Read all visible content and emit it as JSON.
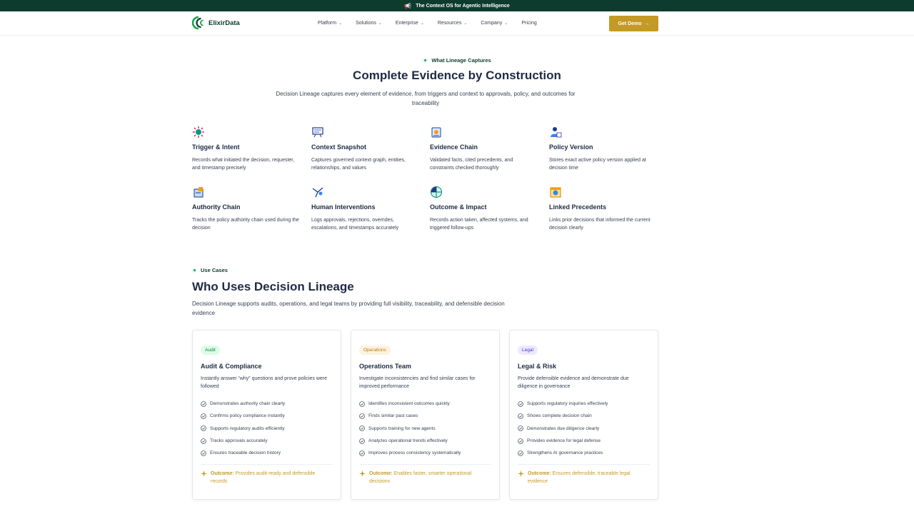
{
  "banner": {
    "icon": "megaphone-icon",
    "text": "The Context OS for Agentic Intelligence"
  },
  "nav": {
    "logo_text": "ElixirData",
    "items": [
      {
        "label": "Platform",
        "dropdown": true
      },
      {
        "label": "Solutions",
        "dropdown": true
      },
      {
        "label": "Enterprise",
        "dropdown": true
      },
      {
        "label": "Resources",
        "dropdown": true
      },
      {
        "label": "Company",
        "dropdown": true
      },
      {
        "label": "Pricing",
        "dropdown": false
      }
    ],
    "cta": "Get Demo",
    "cta_color": "#c49a24"
  },
  "lineage": {
    "eyebrow": "What Lineage Captures",
    "title": "Complete Evidence by Construction",
    "subtitle": "Decision Lineage captures every element of evidence, from triggers and context to approvals, policy, and outcomes for traceability",
    "features": [
      {
        "icon": "trigger-icon",
        "title": "Trigger & Intent",
        "desc": "Records what initiated the decision, requester, and timestamp precisely"
      },
      {
        "icon": "context-snapshot-icon",
        "title": "Context Snapshot",
        "desc": "Captures governed context graph, entities, relationships, and values"
      },
      {
        "icon": "evidence-chain-icon",
        "title": "Evidence Chain",
        "desc": "Validated facts, cited precedents, and constraints checked thoroughly"
      },
      {
        "icon": "policy-user-icon",
        "title": "Policy Version",
        "desc": "Stores exact active policy version applied at decision time"
      },
      {
        "icon": "authority-chain-icon",
        "title": "Authority Chain",
        "desc": "Tracks the policy authority chain used during the decision"
      },
      {
        "icon": "human-intervention-icon",
        "title": "Human Interventions",
        "desc": "Logs approvals, rejections, overrides, escalations, and timestamps accurately"
      },
      {
        "icon": "globe-impact-icon",
        "title": "Outcome & Impact",
        "desc": "Records action taken, affected systems, and triggered follow-ups"
      },
      {
        "icon": "linked-precedents-icon",
        "title": "Linked Precedents",
        "desc": "Links prior decisions that informed the current decision clearly"
      }
    ]
  },
  "use_cases": {
    "eyebrow": "Use Cases",
    "title": "Who Uses Decision Lineage",
    "subtitle": "Decision Lineage supports audits, operations, and legal teams by providing full visibility, traceability, and defensible decision evidence",
    "cards": [
      {
        "badge": "Audit",
        "badge_bg": "#dcfce7",
        "badge_fg": "#15803d",
        "title": "Audit & Compliance",
        "desc": "Instantly answer “why” questions and prove policies were followed",
        "points": [
          "Demonstrates authority chain clearly",
          "Confirms policy compliance instantly",
          "Supports regulatory audits efficiently",
          "Tracks approvals accurately",
          "Ensures traceable decision history"
        ],
        "outcome_label": "Outcome:",
        "outcome": "Provides audit-ready and defensible records"
      },
      {
        "badge": "Operations",
        "badge_bg": "#fdf3dc",
        "badge_fg": "#b7791f",
        "title": "Operations Team",
        "desc": "Investigate inconsistencies and find similar cases for improved performance",
        "points": [
          "Identifies inconsistent outcomes quickly",
          "Finds similar past cases",
          "Supports training for new agents",
          "Analyzes operational trends effectively",
          "Improves process consistency systematically"
        ],
        "outcome_label": "Outcome:",
        "outcome": "Enables faster, smarter operational decisions"
      },
      {
        "badge": "Legal",
        "badge_bg": "#ede9fe",
        "badge_fg": "#4338ca",
        "title": "Legal & Risk",
        "desc": "Provide defensible evidence and demonstrate due diligence in governance",
        "points": [
          "Supports regulatory inquiries effectively",
          "Shows complete decision chain",
          "Demonstrates due diligence clearly",
          "Provides evidence for legal defense",
          "Strengthens AI governance practices"
        ],
        "outcome_label": "Outcome:",
        "outcome": "Ensures defensible, traceable legal evidence"
      }
    ]
  }
}
